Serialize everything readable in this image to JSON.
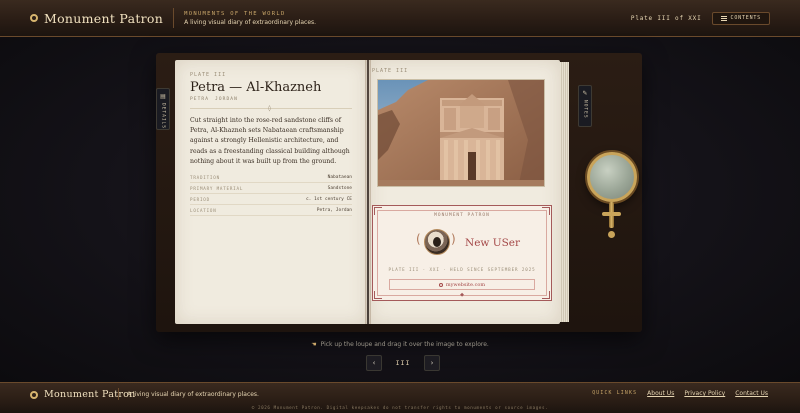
{
  "header": {
    "brand": "Monument Patron",
    "kicker": "MONUMENTS OF THE WORLD",
    "tagline": "A living visual diary of extraordinary places.",
    "plate_indicator": "Plate III of XXI",
    "contents_label": "CONTENTS"
  },
  "tabs": {
    "left": "DETAILS",
    "right": "NOTES"
  },
  "left_page": {
    "kicker": "PLATE III",
    "title": "Petra — Al-Khazneh",
    "location": [
      "PETRA",
      "JORDAN"
    ],
    "description": "Cut straight into the rose-red sandstone cliffs of Petra, Al-Khazneh sets Nabataean craftsmanship against a strongly Hellenistic architecture, and reads as a freestanding classical building although nothing about it was built up from the ground.",
    "facts": [
      {
        "key": "TRADITION",
        "value": "Nabataean"
      },
      {
        "key": "PRIMARY MATERIAL",
        "value": "Sandstone"
      },
      {
        "key": "PERIOD",
        "value": "c. 1st century CE"
      },
      {
        "key": "LOCATION",
        "value": "Petra, Jordan"
      }
    ]
  },
  "right_page": {
    "kicker": "PLATE III",
    "card": {
      "title": "MONUMENT PATRON",
      "patron_name": "New USer",
      "meta": "PLATE III · XXI · HELD SINCE SEPTEMBER 2025",
      "link": "mywebsite.com"
    }
  },
  "hint": "Pick up the loupe and drag it over the image to explore.",
  "pager": {
    "prev": "‹",
    "label": "III",
    "next": "›"
  },
  "footer": {
    "brand": "Monument Patron",
    "tagline": "A living visual diary of extraordinary places.",
    "quick_links_label": "QUICK LINKS",
    "links": [
      "About Us",
      "Privacy Policy",
      "Contact Us"
    ],
    "copyright": "© 2026 Monument Patron. Digital keepsakes do not transfer rights to monuments or source images."
  },
  "colors": {
    "accent_gold": "#caa76a",
    "patron_red": "#a44848",
    "paper": "#f0ebdf"
  }
}
